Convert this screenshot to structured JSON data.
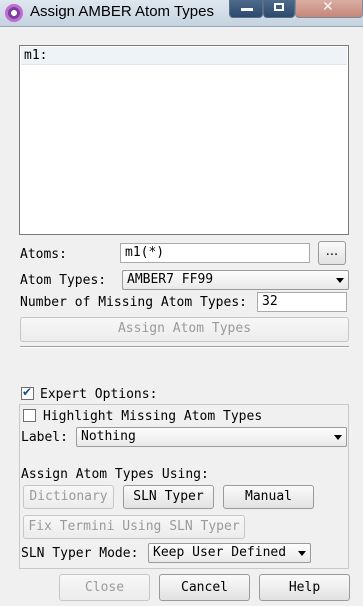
{
  "window": {
    "title": "Assign AMBER Atom Types",
    "close_glyph": "✕"
  },
  "list": {
    "header": "m1:"
  },
  "atoms": {
    "label": "Atoms:",
    "value": "m1(*)",
    "browse_label": "..."
  },
  "atom_types": {
    "label": "Atom Types:",
    "selected": "AMBER7 FF99"
  },
  "missing": {
    "label": "Number of Missing Atom Types:",
    "value": "32"
  },
  "assign_button": "Assign Atom Types",
  "expert": {
    "label": "Expert Options:",
    "checked": true
  },
  "highlight": {
    "label": "Highlight Missing Atom Types",
    "checked": false
  },
  "label_field": {
    "label": "Label:",
    "selected": "Nothing"
  },
  "assign_using": {
    "label": "Assign Atom Types Using:",
    "dictionary": "Dictionary",
    "sln_typer": "SLN Typer",
    "manual": "Manual",
    "fix_termini": "Fix Termini Using SLN Typer"
  },
  "sln_mode": {
    "label": "SLN Typer Mode:",
    "selected": "Keep User Defined"
  },
  "footer": {
    "close": "Close",
    "cancel": "Cancel",
    "help": "Help"
  }
}
